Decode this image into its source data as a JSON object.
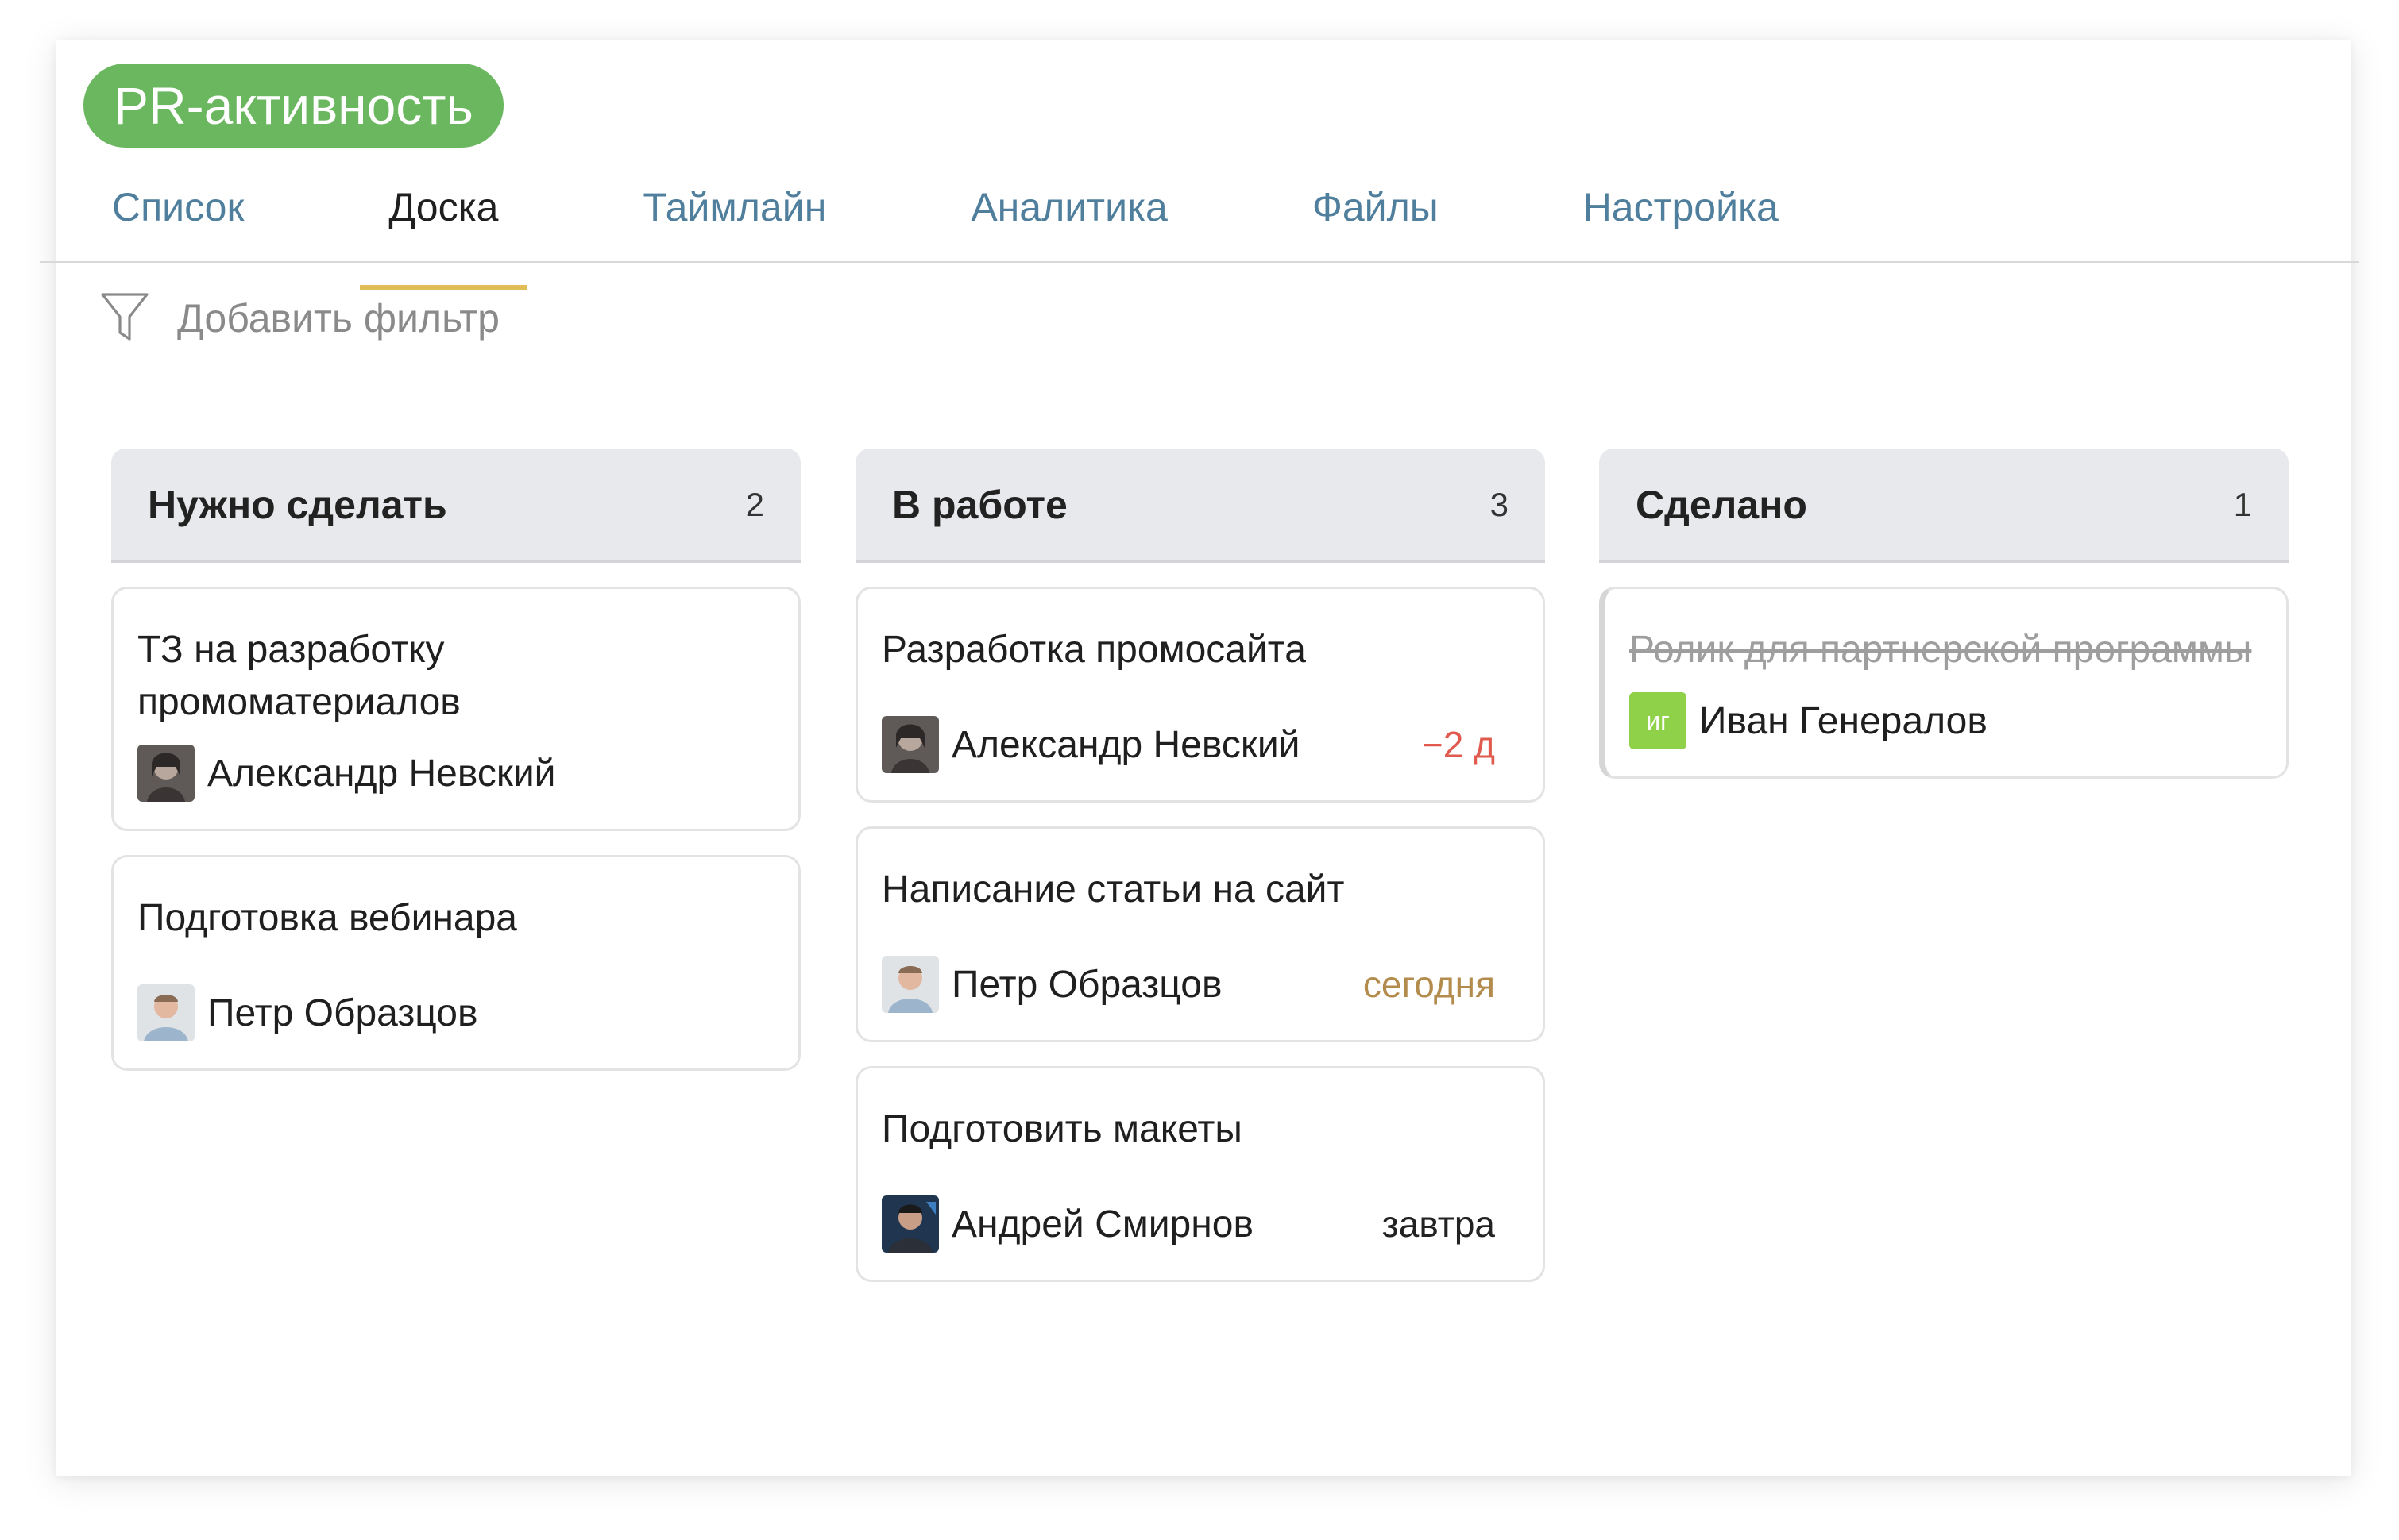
{
  "project": {
    "name": "PR-активность",
    "color": "#6ab75f"
  },
  "tabs": [
    {
      "label": "Список",
      "active": false
    },
    {
      "label": "Доска",
      "active": true
    },
    {
      "label": "Таймлайн",
      "active": false
    },
    {
      "label": "Аналитика",
      "active": false
    },
    {
      "label": "Файлы",
      "active": false
    },
    {
      "label": "Настройка",
      "active": false
    }
  ],
  "filter": {
    "label": "Добавить фильтр",
    "icon": "funnel-icon"
  },
  "columns": [
    {
      "title": "Нужно сделать",
      "count": "2",
      "cards": [
        {
          "title": "ТЗ на разработку промоматериалов",
          "assignee": "Александр Невский",
          "avatar": "photo-nevsky",
          "due": ""
        },
        {
          "title": "Подготовка вебинара",
          "assignee": "Петр Образцов",
          "avatar": "photo-obraztsov",
          "due": ""
        }
      ]
    },
    {
      "title": "В работе",
      "count": "3",
      "cards": [
        {
          "title": "Разработка промосайта",
          "assignee": "Александр Невский",
          "avatar": "photo-nevsky",
          "due": "−2 д",
          "due_color": "#e05a4e"
        },
        {
          "title": "Написание статьи на сайт",
          "assignee": "Петр Образцов",
          "avatar": "photo-obraztsov",
          "due": "сегодня",
          "due_color": "#b38b4d"
        },
        {
          "title": "Подготовить макеты",
          "assignee": "Андрей Смирнов",
          "avatar": "photo-smirnov",
          "due": "завтра",
          "due_color": "#222222"
        }
      ]
    },
    {
      "title": "Сделано",
      "count": "1",
      "cards": [
        {
          "title": "Ролик для партнерской программы",
          "assignee": "Иван Генералов",
          "avatar": "initials",
          "initials": "иг",
          "due": "",
          "done": true
        }
      ]
    }
  ]
}
